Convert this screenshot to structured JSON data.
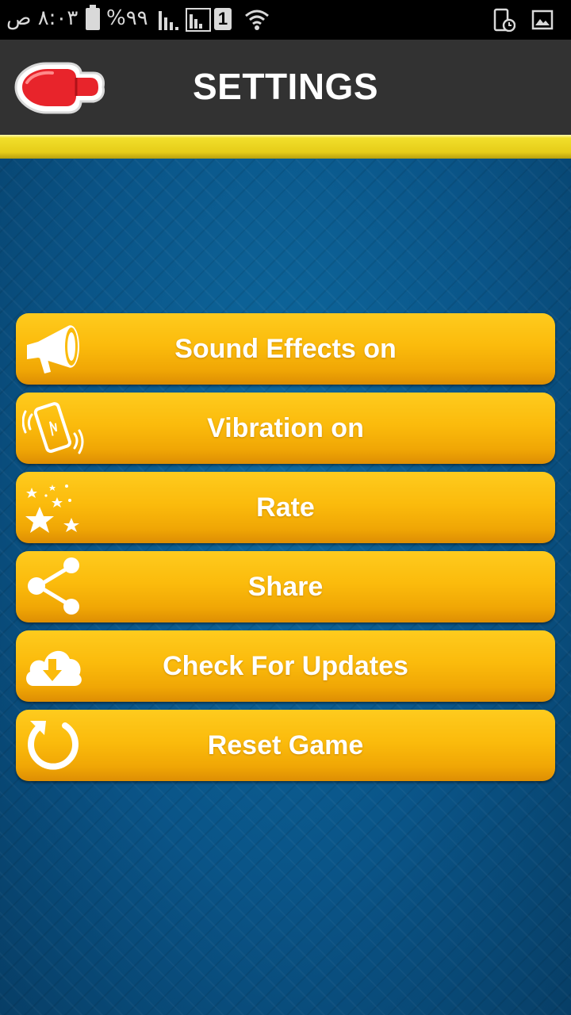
{
  "status_bar": {
    "time": "٨:٠٣ ص",
    "battery_percent": "%٩٩",
    "sim_number": "1"
  },
  "header": {
    "title": "SETTINGS",
    "back_icon": "red-glove-pointing-left-icon"
  },
  "colors": {
    "header_bg": "#323232",
    "stripe": "#e6cd19",
    "background": "#0b4f7d",
    "button": "#fbbb0c",
    "button_text": "#ffffff"
  },
  "menu": [
    {
      "label": "Sound Effects on",
      "icon": "megaphone-icon"
    },
    {
      "label": "Vibration on",
      "icon": "vibrating-phone-icon"
    },
    {
      "label": "Rate",
      "icon": "stars-icon"
    },
    {
      "label": "Share",
      "icon": "share-icon"
    },
    {
      "label": "Check For Updates",
      "icon": "cloud-download-icon"
    },
    {
      "label": "Reset Game",
      "icon": "reset-icon"
    }
  ]
}
